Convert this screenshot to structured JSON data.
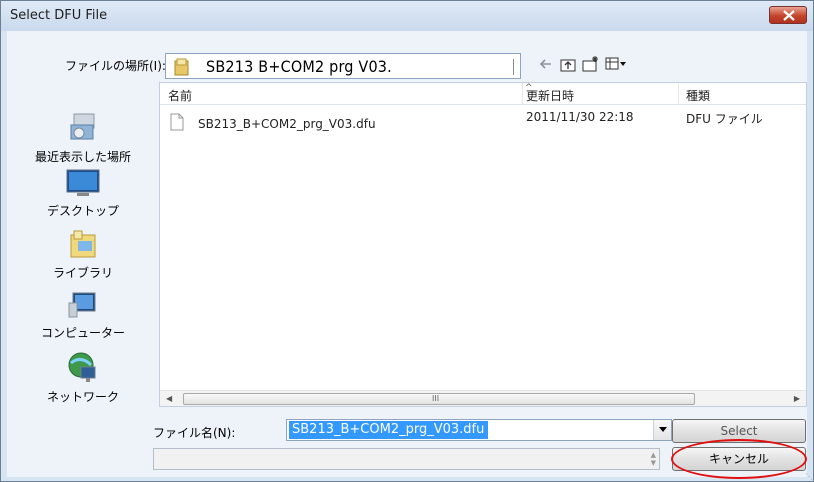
{
  "window": {
    "title": "Select DFU File",
    "close_icon": "close-icon"
  },
  "lookin": {
    "label": "ファイルの場所(I):",
    "value": "SB213 B+COM2 prg V03.",
    "icon": "folder-icon"
  },
  "toolbar": {
    "icons": [
      "back-arrow-icon",
      "up-folder-icon",
      "new-folder-icon",
      "view-menu-icon"
    ]
  },
  "places": [
    {
      "label": "最近表示した場所",
      "icon": "recent-places-icon"
    },
    {
      "label": "デスクトップ",
      "icon": "desktop-icon"
    },
    {
      "label": "ライブラリ",
      "icon": "libraries-icon"
    },
    {
      "label": "コンピューター",
      "icon": "computer-icon"
    },
    {
      "label": "ネットワーク",
      "icon": "network-icon"
    }
  ],
  "filelist": {
    "columns": [
      "名前",
      "更新日時",
      "種類"
    ],
    "rows": [
      {
        "name": "SB213_B+COM2_prg_V03.dfu",
        "modified": "2011/11/30 22:18",
        "type": "DFU ファイル"
      }
    ],
    "scroll_grip": "III"
  },
  "filename": {
    "label": "ファイル名(N):",
    "value": "SB213_B+COM2_prg_V03.dfu"
  },
  "buttons": {
    "select": "Select",
    "cancel": "キャンセル"
  },
  "colors": {
    "selection": "#3399ff",
    "annotation": "#e01010",
    "close_button": "#c4452d"
  }
}
